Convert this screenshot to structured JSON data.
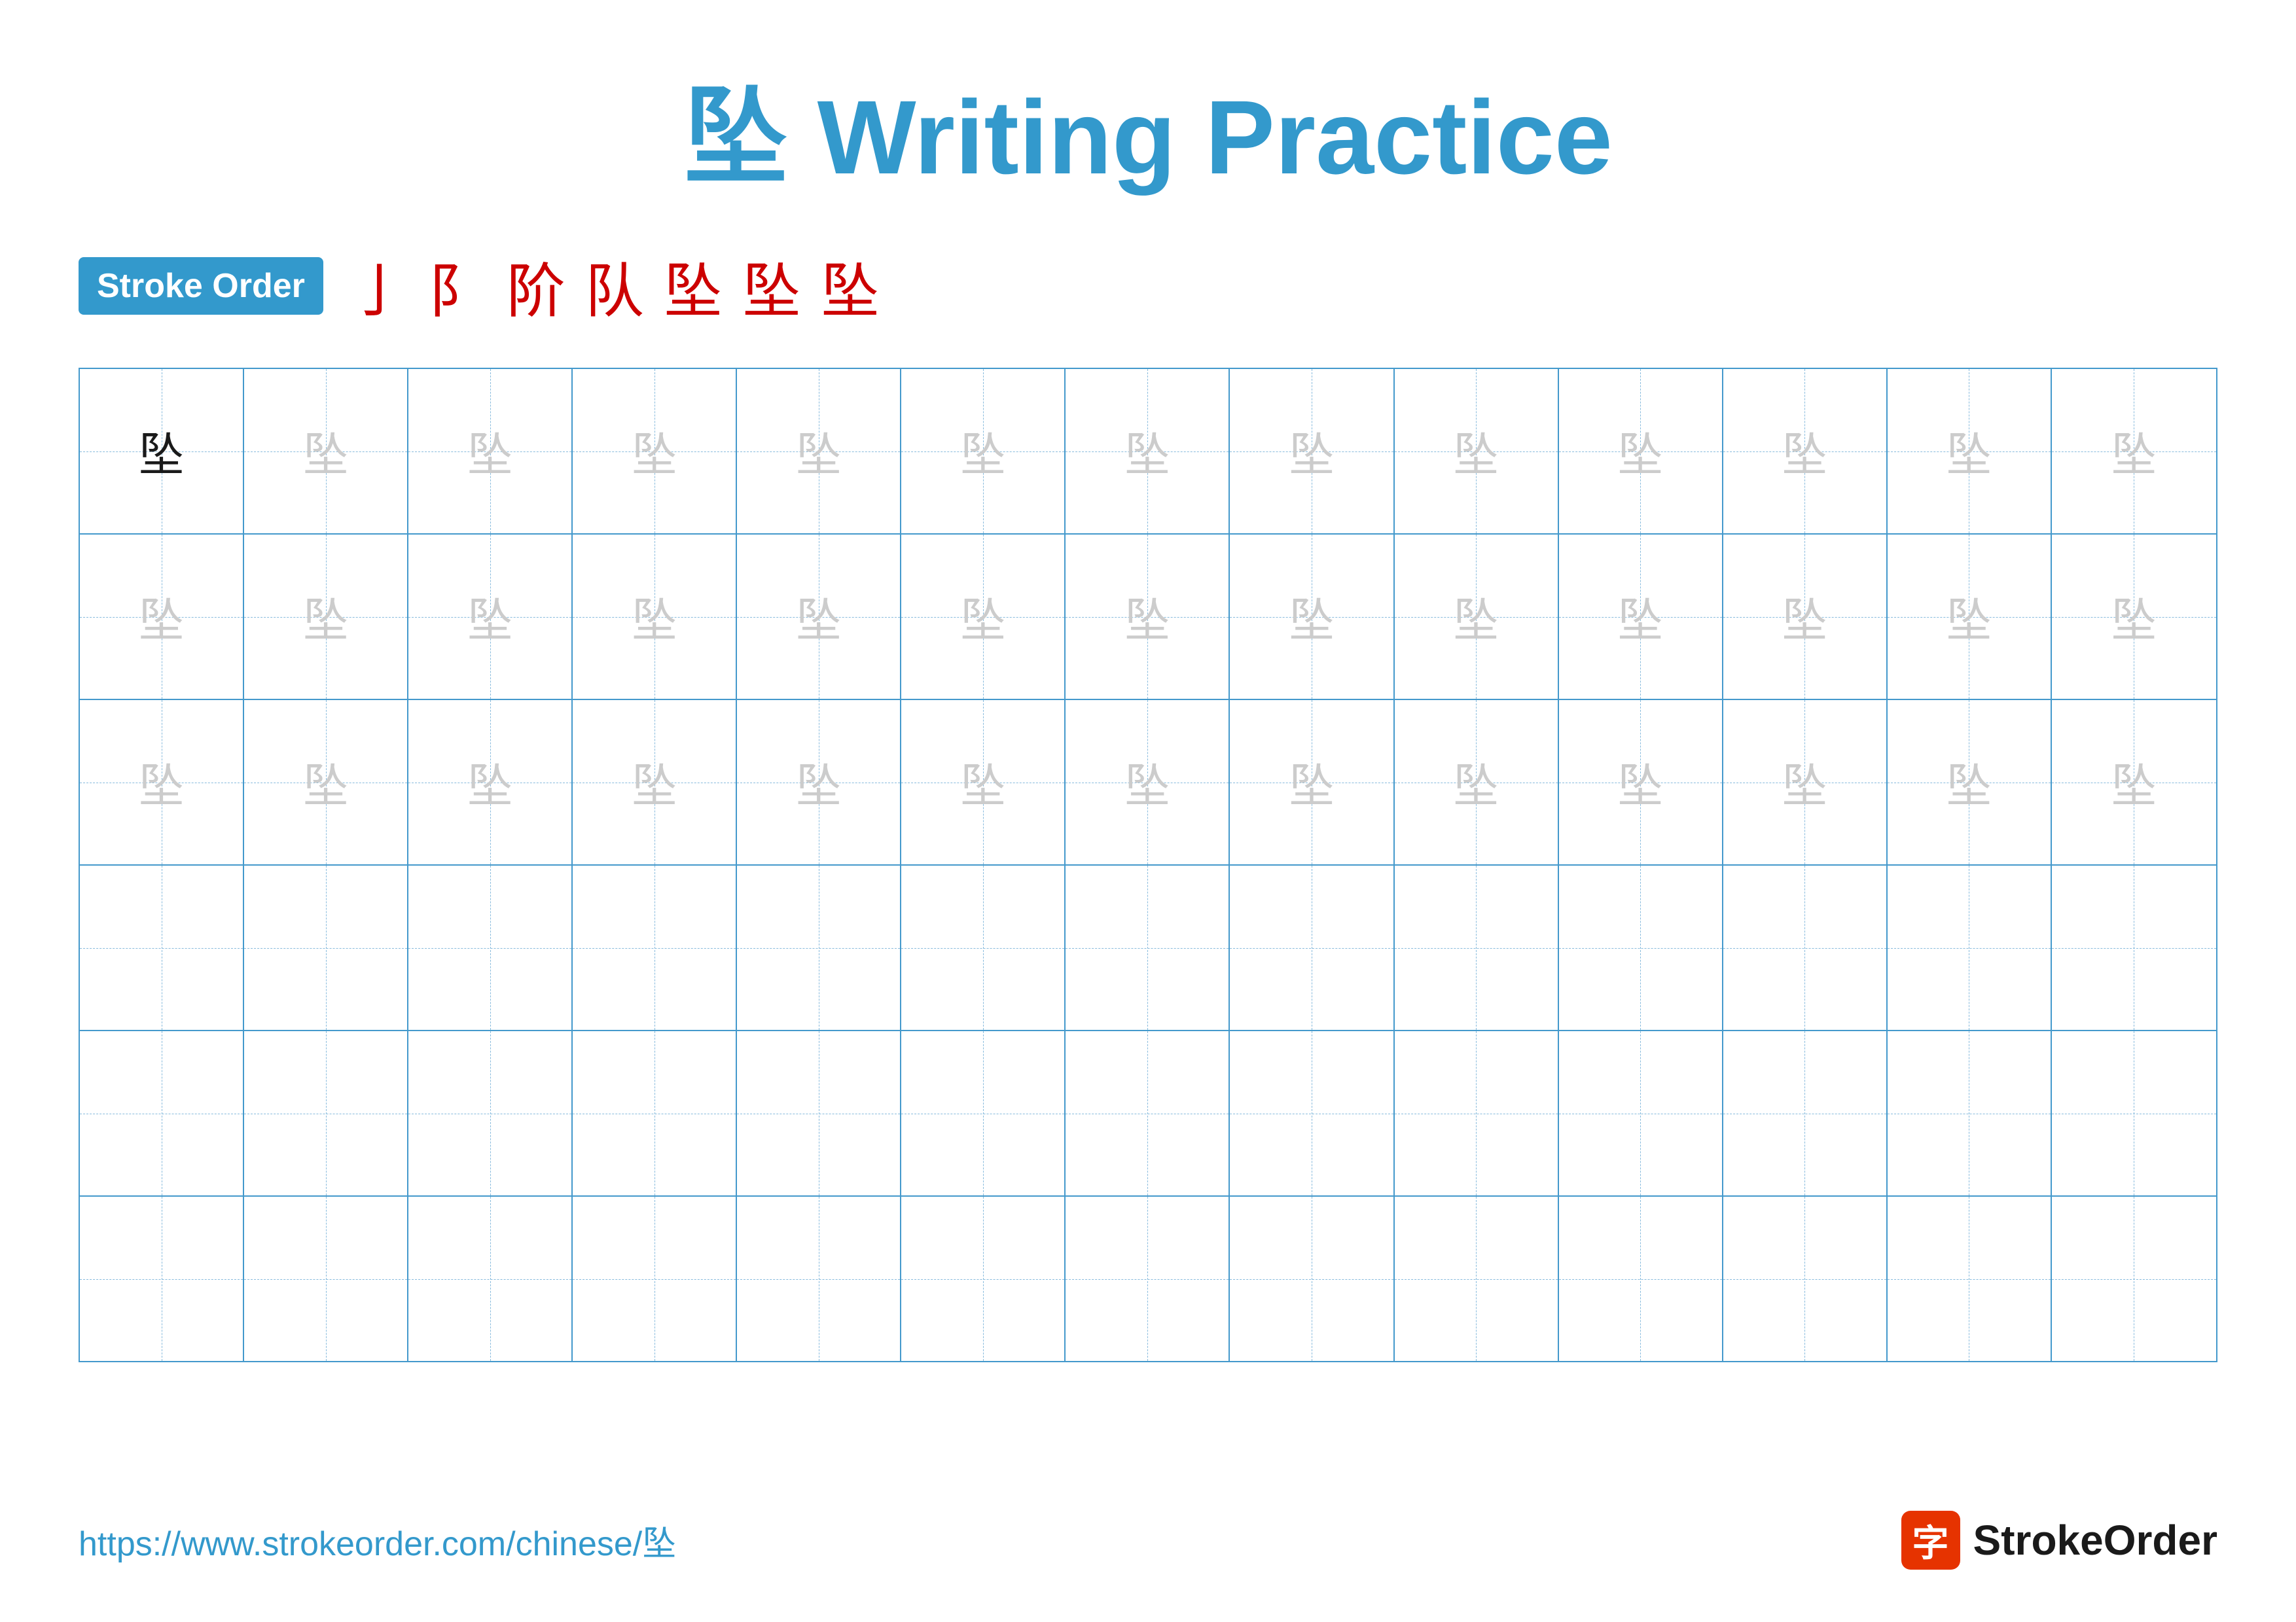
{
  "title": {
    "char": "坠",
    "text": " Writing Practice"
  },
  "stroke_order": {
    "badge_label": "Stroke Order",
    "steps": [
      "亅",
      "阝",
      "阶",
      "队",
      "坠",
      "坠",
      "坠"
    ]
  },
  "grid": {
    "rows": 6,
    "cols": 13,
    "char": "坠",
    "filled_rows": 3
  },
  "footer": {
    "url": "https://www.strokeorder.com/chinese/坠",
    "logo_char": "字",
    "logo_name": "StrokeOrder"
  }
}
